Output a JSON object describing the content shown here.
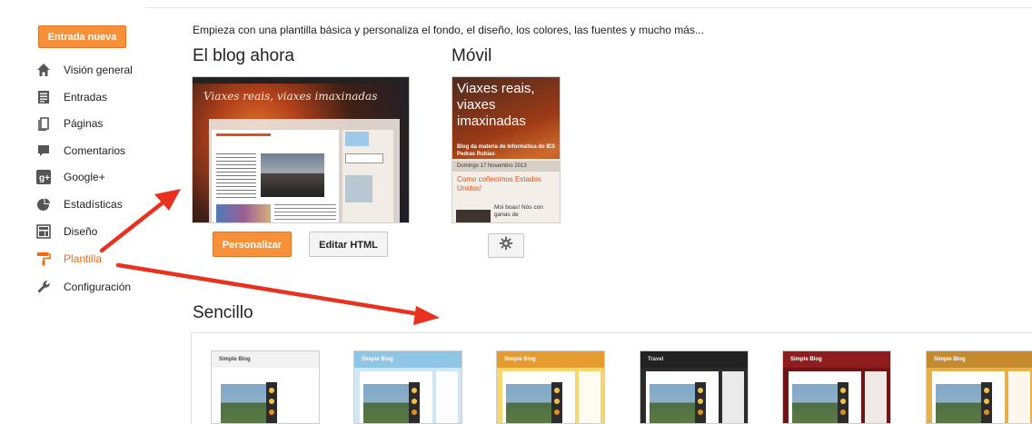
{
  "sidebar": {
    "new_button": "Entrada nueva",
    "items": [
      {
        "label": "Visión general",
        "icon": "home-icon"
      },
      {
        "label": "Entradas",
        "icon": "posts-icon"
      },
      {
        "label": "Páginas",
        "icon": "pages-icon"
      },
      {
        "label": "Comentarios",
        "icon": "comments-icon"
      },
      {
        "label": "Google+",
        "icon": "google-plus-icon"
      },
      {
        "label": "Estadísticas",
        "icon": "stats-icon"
      },
      {
        "label": "Diseño",
        "icon": "layout-icon"
      },
      {
        "label": "Plantilla",
        "icon": "template-icon",
        "active": true
      },
      {
        "label": "Configuración",
        "icon": "wrench-icon"
      }
    ]
  },
  "main": {
    "intro": "Empieza con una plantilla básica y personaliza el fondo, el diseño, los colores, las fuentes y mucho más...",
    "current_blog_heading": "El blog ahora",
    "mobile_heading": "Móvil",
    "customize_button": "Personalizar",
    "edit_html_button": "Editar HTML",
    "simple_heading": "Sencillo",
    "blog_preview": {
      "title": "Viaxes reais, viaxes imaxinadas"
    },
    "mobile_preview": {
      "title": "Viaxes reais, viaxes imaxinadas",
      "subtitle": "Blog da materia de Informática do IES Pedras Rubias",
      "date": "Domingo 17 Novembro 2013",
      "post_title": "Como coñecimos Estados Unidos!",
      "snippet": "Moi boas! Nós con ganas de"
    },
    "templates": [
      {
        "title": "Simple Blog",
        "header_bg": "#f2f2f2",
        "header_color": "#444444",
        "page_bg": "#ffffff"
      },
      {
        "title": "Simple Blog",
        "header_bg": "#8fc6e6",
        "header_color": "#ffffff",
        "page_bg": "#cfe6f3"
      },
      {
        "title": "Simple Blog",
        "header_bg": "#e59b2e",
        "header_color": "#ffffff",
        "page_bg": "#f5d76d"
      },
      {
        "title": "Travel",
        "header_bg": "#222222",
        "header_color": "#dddddd",
        "page_bg": "#2b2b2b"
      },
      {
        "title": "Simple Blog",
        "header_bg": "#8f1d1d",
        "header_color": "#ffffff",
        "page_bg": "#6f1414"
      },
      {
        "title": "Simple Blog",
        "header_bg": "#c58a2e",
        "header_color": "#ffffff",
        "page_bg": "#e4b14a"
      }
    ]
  },
  "colors": {
    "accent": "#f6913a",
    "active_text": "#f56a11",
    "annotation_arrow": "#e8321f"
  }
}
